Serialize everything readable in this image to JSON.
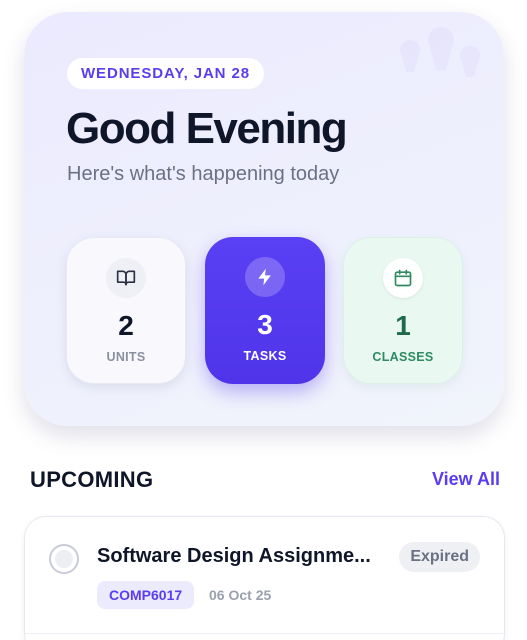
{
  "header": {
    "date": "WEDNESDAY, JAN 28",
    "greeting": "Good Evening",
    "subtitle": "Here's what's happening today"
  },
  "stats": [
    {
      "value": "2",
      "label": "UNITS",
      "icon": "book-icon"
    },
    {
      "value": "3",
      "label": "TASKS",
      "icon": "lightning-icon"
    },
    {
      "value": "1",
      "label": "CLASSES",
      "icon": "calendar-icon"
    }
  ],
  "upcoming": {
    "title": "UPCOMING",
    "view_all": "View All",
    "items": [
      {
        "title": "Software Design Assignme...",
        "status": "Expired",
        "course": "COMP6017",
        "date": "06 Oct 25"
      }
    ]
  },
  "colors": {
    "accent": "#5b3df0",
    "tasks_tile": "#5038ec",
    "classes_tile": "#eaf8f2",
    "classes_text": "#2f8a62",
    "status_expired_bg": "#eef0f4"
  }
}
